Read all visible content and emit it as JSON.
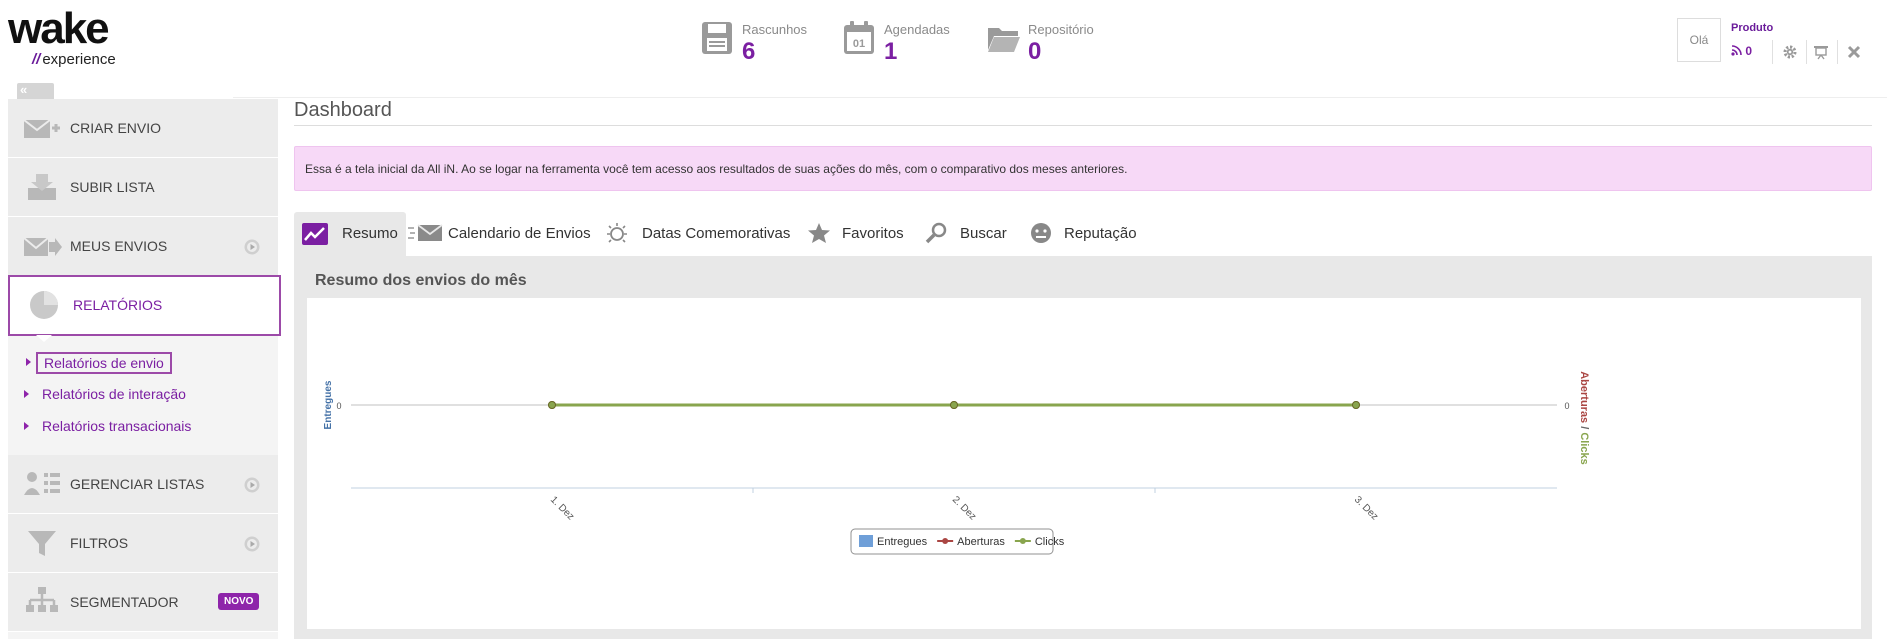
{
  "brand": {
    "logo_main": "wake",
    "logo_sub": "experience",
    "logo_slash": "//"
  },
  "header_stats": [
    {
      "label": "Rascunhos",
      "value": "6",
      "icon": "floppy-disk-icon"
    },
    {
      "label": "Agendadas",
      "value": "1",
      "icon": "calendar-icon"
    },
    {
      "label": "Repositório",
      "value": "0",
      "icon": "folder-icon"
    }
  ],
  "user": {
    "greeting": "Olá",
    "product_label": "Produto",
    "rss_count": "0"
  },
  "sidebar": {
    "collapse_label": "«",
    "items": [
      {
        "label": "CRIAR ENVIO",
        "icon": "create-envelope-icon"
      },
      {
        "label": "SUBIR LISTA",
        "icon": "upload-list-icon"
      },
      {
        "label": "MEUS ENVIOS",
        "icon": "sent-envelope-icon"
      },
      {
        "label": "RELATÓRIOS",
        "icon": "pie-chart-icon"
      },
      {
        "label": "GERENCIAR LISTAS",
        "icon": "manage-lists-icon"
      },
      {
        "label": "FILTROS",
        "icon": "funnel-icon"
      },
      {
        "label": "SEGMENTADOR",
        "icon": "hierarchy-icon",
        "badge": "NOVO"
      }
    ],
    "submenu": [
      {
        "label": "Relatórios de envio"
      },
      {
        "label": "Relatórios de interação"
      },
      {
        "label": "Relatórios transacionais"
      }
    ]
  },
  "main": {
    "title": "Dashboard",
    "info": "Essa é a tela inicial da All iN. Ao se logar na ferramenta você tem acesso aos resultados de suas ações do mês, com o comparativo dos meses anteriores.",
    "tabs": [
      {
        "label": "Resumo",
        "icon": "trend-line-icon"
      },
      {
        "label": "Calendario de Envios",
        "icon": "fast-envelope-icon"
      },
      {
        "label": "Datas Comemorativas",
        "icon": "lightbulb-icon"
      },
      {
        "label": "Favoritos",
        "icon": "star-icon"
      },
      {
        "label": "Buscar",
        "icon": "magnifier-icon"
      },
      {
        "label": "Reputação",
        "icon": "face-icon"
      }
    ],
    "panel_title": "Resumo dos envios do mês"
  },
  "colors": {
    "accent": "#7b1fa2",
    "entregues": "#6f9fd8",
    "aberturas": "#aa4643",
    "clicks": "#89a54e"
  },
  "chart_data": {
    "type": "line",
    "categories": [
      "1. Dez",
      "2. Dez",
      "3. Dez"
    ],
    "series": [
      {
        "name": "Entregues",
        "values": [
          0,
          0,
          0
        ]
      },
      {
        "name": "Aberturas",
        "values": [
          0,
          0,
          0
        ]
      },
      {
        "name": "Clicks",
        "values": [
          0,
          0,
          0
        ]
      }
    ],
    "ylabel_left": "Entregues",
    "ylabel_right_a": "Aberturas",
    "ylabel_right_sep": "/",
    "ylabel_right_b": "Clicks",
    "ytick_left": "0",
    "ytick_right": "0",
    "legend_position": "bottom-center"
  }
}
